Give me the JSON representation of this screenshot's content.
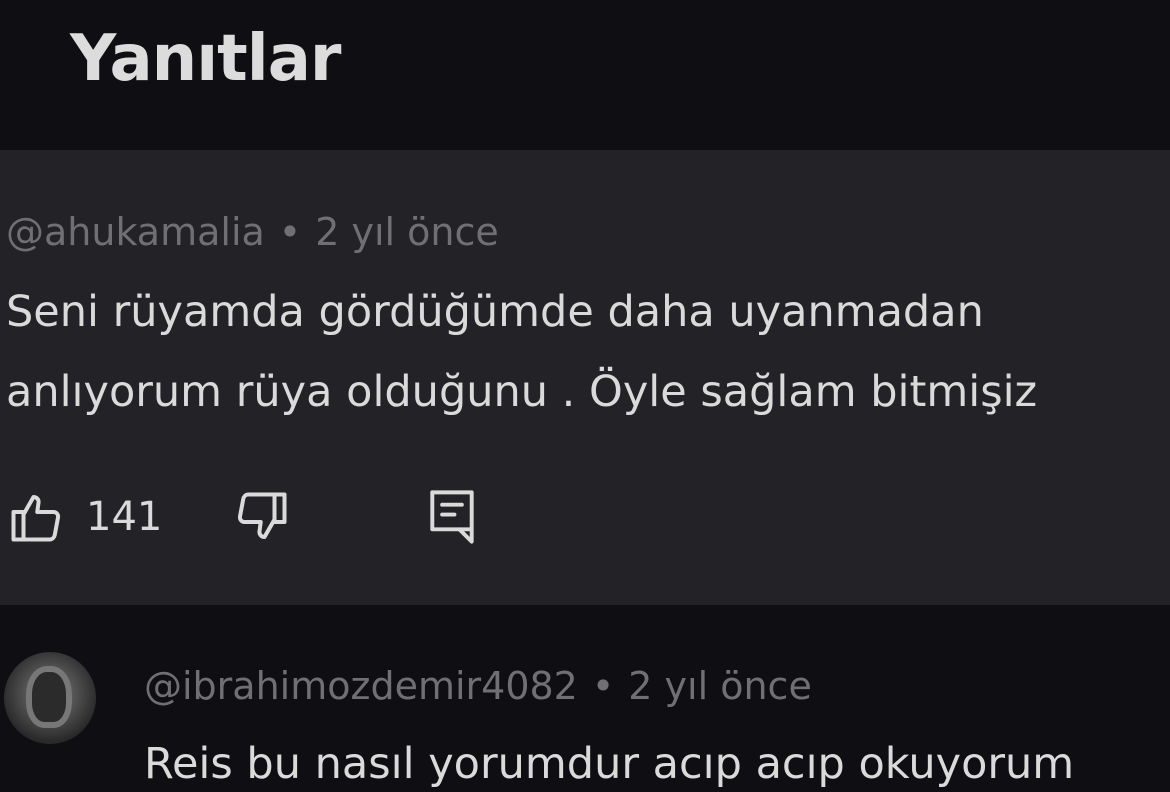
{
  "header": {
    "title": "Yanıtlar"
  },
  "highlight_comment": {
    "author": "@ahukamalia",
    "separator": "•",
    "time": "2 yıl önce",
    "text_lines": [
      "Seni rüyamda gördüğümde daha uyanmadan",
      "anlıyorum rüya olduğunu . Öyle sağlam bitmişiz"
    ],
    "like_count": "141",
    "icons": {
      "like": "thumbs-up-icon",
      "dislike": "thumbs-down-icon",
      "reply": "comment-reply-icon"
    }
  },
  "reply_comment": {
    "author": "@ibrahimozdemir4082",
    "separator": "•",
    "time": "2 yıl önce",
    "text": "Reis bu nasıl yorumdur acıp acıp okuyorum"
  },
  "colors": {
    "background": "#0f0e12",
    "highlight_background": "#232226",
    "text_primary": "#dadada",
    "text_secondary": "#6f6f74"
  }
}
